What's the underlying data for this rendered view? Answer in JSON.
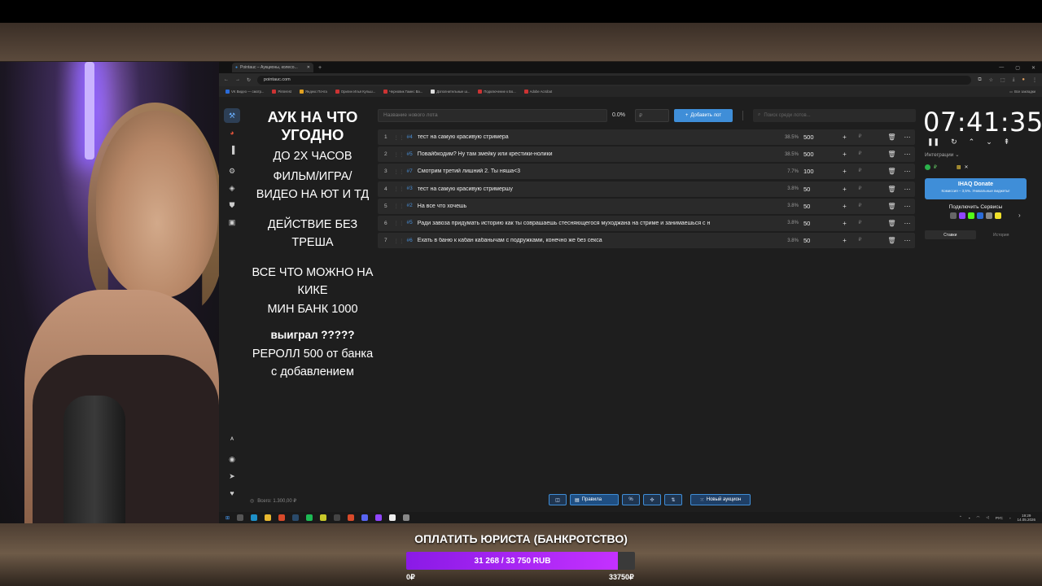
{
  "browser": {
    "tab_title": "Pointauc – Аукционы, колесо...",
    "url": "pointauc.com",
    "bookmarks": [
      "VK Видео — смотр...",
      "Pinterest",
      "Яндекс Почта",
      "Оригин Илья Кульш...",
      "Черновик Гамес Ва...",
      "Дополнительные ш...",
      "Подключение к Бо...",
      "Adobe Acrobat"
    ],
    "bookmarks_right": "Все закладки"
  },
  "banner": {
    "line1": "АУК НА ЧТО УГОДНО",
    "line2": "ДО 2Х ЧАСОВ",
    "line3": "ФИЛЬМ/ИГРА/ ВИДЕО НА ЮТ И ТД",
    "line4": "ДЕЙСТВИЕ БЕЗ ТРЕША",
    "line5": "ВСЕ ЧТО МОЖНО НА КИКЕ",
    "line6": "МИН БАНК 1000",
    "line7": "выиграл ?????",
    "line8": "РЕРОЛЛ 500 от банка с добавлением"
  },
  "toolbar": {
    "lot_placeholder": "Название нового лота",
    "percent": "0.0%",
    "amount_placeholder": "₽",
    "add_label": "Добавить лот",
    "search_placeholder": "Поиск среди лотов..."
  },
  "lots": [
    {
      "num": "1",
      "id": "#4",
      "name": "тест на самую красивую стримера",
      "share": "38.5%",
      "value": "500"
    },
    {
      "num": "2",
      "id": "#5",
      "name": "Повайбкодим? Ну там змейку или крестики-нолики",
      "share": "38.5%",
      "value": "500"
    },
    {
      "num": "3",
      "id": "#7",
      "name": "Смотрим третий лишний 2. Ты няша<3",
      "share": "7.7%",
      "value": "100"
    },
    {
      "num": "4",
      "id": "#3",
      "name": "тест на самую красивую стримершу",
      "share": "3.8%",
      "value": "50"
    },
    {
      "num": "5",
      "id": "#2",
      "name": "На все что хочешь",
      "share": "3.8%",
      "value": "50"
    },
    {
      "num": "6",
      "id": "#5",
      "name": "Ради завоза придумать историю как ты соврашаешь стесняющегося муходжана на стриме и занимаешься с н",
      "share": "3.8%",
      "value": "50"
    },
    {
      "num": "7",
      "id": "#6",
      "name": "Ехать в баню к кабан кабанычам с подружками, конечно же без секса",
      "share": "3.8%",
      "value": "50"
    }
  ],
  "timer": {
    "value": "07:41:35"
  },
  "integrations": {
    "label": "Интеграции ⌄",
    "donate_title": "IHAQ Donate",
    "donate_sub": "Комиссия – 3,5%. Уникальные виджеты!",
    "services_label": "Подключить Сервисы",
    "tab_bets": "Ставки",
    "tab_history": "История"
  },
  "footer": {
    "total_label": "Всего: 1.300,00 ₽",
    "rules_label": "Правила",
    "new_auction_label": "Новый аукцион"
  },
  "taskbar": {
    "lang": "РУС",
    "time": "19:29",
    "date": "14.05.2026"
  },
  "goal": {
    "title": "ОПЛАТИТЬ ЮРИСТА (БАНКРОТСТВО)",
    "progress_text": "31 268 / 33 750 RUB",
    "current": 31268,
    "target": 33750,
    "min_label": "0₽",
    "max_label": "33750₽"
  },
  "colors": {
    "accent": "#3f8ed8",
    "goal_fill": "#c431ff",
    "panel": "#1e1e1e"
  }
}
